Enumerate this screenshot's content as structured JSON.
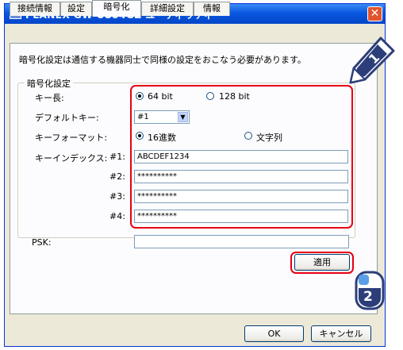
{
  "window": {
    "title": "PLANEX GW-US54GZ ユーティリティ",
    "close_symbol": "✕"
  },
  "tabs": [
    {
      "label": "接続情報"
    },
    {
      "label": "設定"
    },
    {
      "label": "暗号化"
    },
    {
      "label": "詳細設定"
    },
    {
      "label": "情報"
    }
  ],
  "panel": {
    "description": "暗号化設定は通信する機器同士で同様の設定をおこなう必要があります。"
  },
  "group": {
    "title": "暗号化設定",
    "key_length": {
      "label": "キー長:",
      "option1": "64 bit",
      "option2": "128 bit",
      "selected": "64 bit"
    },
    "default_key": {
      "label": "デフォルトキー:",
      "value": "#1"
    },
    "key_format": {
      "label": "キーフォーマット:",
      "option1": "16進数",
      "option2": "文字列",
      "selected": "16進数"
    },
    "key_index": {
      "label": "キーインデックス:",
      "keys": [
        {
          "label": "#1:",
          "value": "ABCDEF1234"
        },
        {
          "label": "#2:",
          "value": "**********"
        },
        {
          "label": "#3:",
          "value": "**********"
        },
        {
          "label": "#4:",
          "value": "**********"
        }
      ]
    }
  },
  "psk": {
    "label": "PSK:",
    "value": ""
  },
  "apply_button": {
    "label": "適用"
  },
  "footer": {
    "ok_label": "OK",
    "cancel_label": "キャンセル"
  },
  "callouts": {
    "step1": "1",
    "step2": "2"
  },
  "colors": {
    "highlight": "#e60012",
    "titlebar": "#0a58e0",
    "callout_fill": "#2c3e7a"
  }
}
